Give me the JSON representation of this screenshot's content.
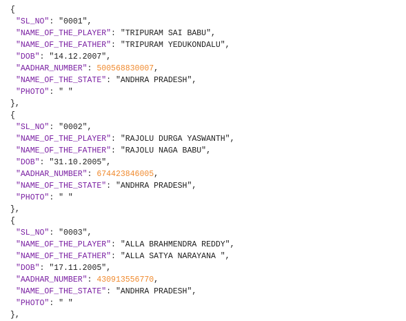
{
  "records": [
    {
      "fields": [
        {
          "key": "\"SL_NO\"",
          "value": "\"0001\"",
          "type": "string",
          "trailing": ","
        },
        {
          "key": "\"NAME_OF_THE_PLAYER\"",
          "value": "\"TRIPURAM SAI BABU\"",
          "type": "string",
          "trailing": ","
        },
        {
          "key": "\"NAME_OF_THE_FATHER\"",
          "value": "\"TRIPURAM YEDUKONDALU\"",
          "type": "string",
          "trailing": ","
        },
        {
          "key": "\"DOB\"",
          "value": "\"14.12.2007\"",
          "type": "string",
          "trailing": ","
        },
        {
          "key": "\"AADHAR_NUMBER\"",
          "value": "500568830007",
          "type": "number",
          "trailing": ","
        },
        {
          "key": "\"NAME_OF_THE_STATE\"",
          "value": "\"ANDHRA PRADESH\"",
          "type": "string",
          "trailing": ","
        },
        {
          "key": "\"PHOTO\"",
          "value": "\" \"",
          "type": "string",
          "trailing": ""
        }
      ]
    },
    {
      "fields": [
        {
          "key": "\"SL_NO\"",
          "value": "\"0002\"",
          "type": "string",
          "trailing": ","
        },
        {
          "key": "\"NAME_OF_THE_PLAYER\"",
          "value": "\"RAJOLU DURGA YASWANTH\"",
          "type": "string",
          "trailing": ","
        },
        {
          "key": "\"NAME_OF_THE_FATHER\"",
          "value": "\"RAJOLU NAGA BABU\"",
          "type": "string",
          "trailing": ","
        },
        {
          "key": "\"DOB\"",
          "value": "\"31.10.2005\"",
          "type": "string",
          "trailing": ","
        },
        {
          "key": "\"AADHAR_NUMBER\"",
          "value": "674423846005",
          "type": "number",
          "trailing": ","
        },
        {
          "key": "\"NAME_OF_THE_STATE\"",
          "value": "\"ANDHRA PRADESH\"",
          "type": "string",
          "trailing": ","
        },
        {
          "key": "\"PHOTO\"",
          "value": "\" \"",
          "type": "string",
          "trailing": ""
        }
      ]
    },
    {
      "fields": [
        {
          "key": "\"SL_NO\"",
          "value": "\"0003\"",
          "type": "string",
          "trailing": ","
        },
        {
          "key": "\"NAME_OF_THE_PLAYER\"",
          "value": "\"ALLA BRAHMENDRA REDDY\"",
          "type": "string",
          "trailing": ","
        },
        {
          "key": "\"NAME_OF_THE_FATHER\"",
          "value": "\"ALLA SATYA NARAYANA \"",
          "type": "string",
          "trailing": ","
        },
        {
          "key": "\"DOB\"",
          "value": "\"17.11.2005\"",
          "type": "string",
          "trailing": ","
        },
        {
          "key": "\"AADHAR_NUMBER\"",
          "value": "430913556770",
          "type": "number",
          "trailing": ","
        },
        {
          "key": "\"NAME_OF_THE_STATE\"",
          "value": "\"ANDHRA PRADESH\"",
          "type": "string",
          "trailing": ","
        },
        {
          "key": "\"PHOTO\"",
          "value": "\" \"",
          "type": "string",
          "trailing": ""
        }
      ]
    }
  ],
  "syntax": {
    "open_brace": "{",
    "close_brace": "},",
    "separator": ": "
  },
  "colors": {
    "key": "#7a1fa2",
    "string": "#1c1c1c",
    "number": "#f08a2e",
    "punctuation": "#1c1c1c"
  }
}
